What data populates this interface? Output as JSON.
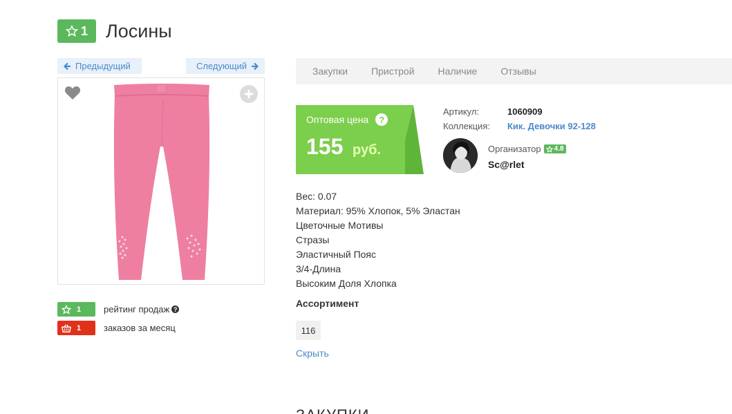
{
  "header": {
    "rating": "1",
    "title": "Лосины"
  },
  "nav": {
    "prev_label": "Предыдущий",
    "next_label": "Следующий"
  },
  "tabs": [
    "Закупки",
    "Пристрой",
    "Наличие",
    "Отзывы"
  ],
  "price": {
    "label": "Оптовая цена",
    "help": "?",
    "value": "155",
    "currency": "руб."
  },
  "meta": {
    "article_label": "Артикул:",
    "article_value": "1060909",
    "collection_label": "Коллекция:",
    "collection_value": "Кик. Девочки 92-128"
  },
  "organizer": {
    "label": "Организатор",
    "rating": "4.8",
    "name": "Sc@rlet"
  },
  "description": [
    "Вес: 0.07",
    "Материал: 95% Хлопок, 5% Эластан",
    "Цветочные Мотивы",
    "Стразы",
    "Эластичный Пояс",
    "3/4-Длина",
    "Высоким Доля Хлопка"
  ],
  "stats": {
    "sales_rating": "1",
    "sales_rating_label": "рейтинг продаж",
    "orders": "1",
    "orders_label": "заказов за месяц"
  },
  "assortment": {
    "title": "Ассортимент",
    "sizes": [
      "116"
    ],
    "hide_label": "Скрыть"
  },
  "bottom": {
    "heading": "ЗАКУПКИ"
  },
  "colors": {
    "green": "#5cb85c",
    "price_green": "#7ccf4c",
    "red": "#e0321b",
    "link": "#4a8ac9",
    "product": "#ee7fa1"
  }
}
